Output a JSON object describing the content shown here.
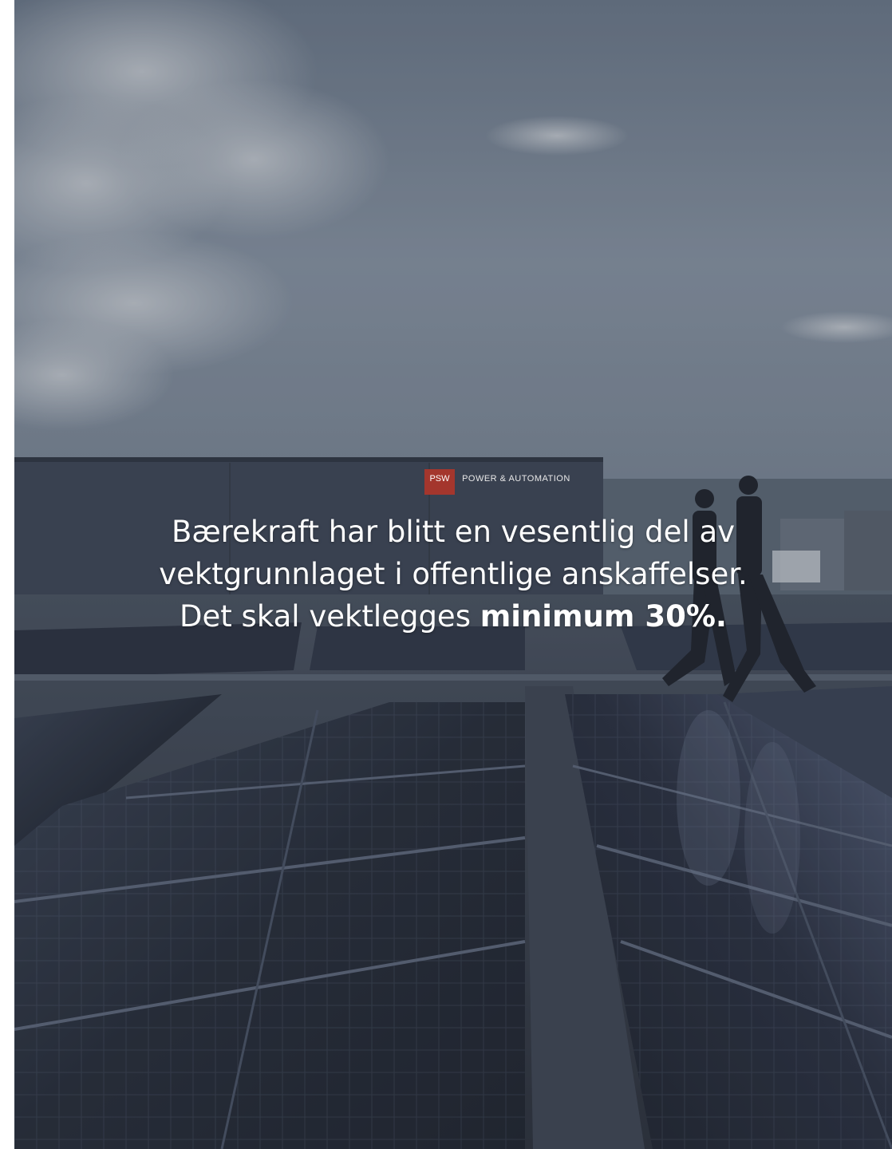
{
  "slide": {
    "sign": {
      "brand": "PSW",
      "tagline": "POWER & AUTOMATION"
    },
    "caption": {
      "line1": "Bærekraft har blitt en vesentlig del av",
      "line2": "vektgrunnlaget i offentlige anskaffelser.",
      "line3_prefix": "Det skal vektlegges ",
      "line3_bold": "minimum 30%."
    }
  },
  "colors": {
    "sky_top": "#6f7d8e",
    "sky_bottom": "#8c98a6",
    "panel": "#2b3140",
    "accent_red": "#c0392b",
    "caption_text": "#ffffff"
  }
}
